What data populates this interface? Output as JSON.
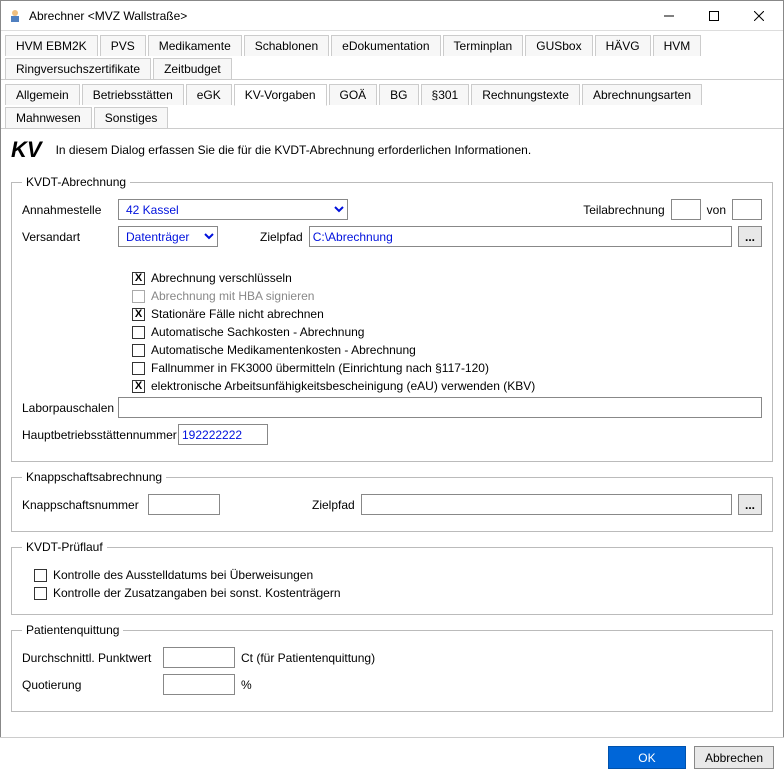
{
  "window": {
    "title": "Abrechner <MVZ Wallstraße>"
  },
  "tabs_row1": [
    "HVM EBM2K",
    "PVS",
    "Medikamente",
    "Schablonen",
    "eDokumentation",
    "Terminplan",
    "GUSbox",
    "HÄVG",
    "HVM",
    "Ringversuchszertifikate",
    "Zeitbudget"
  ],
  "tabs_row2": [
    "Allgemein",
    "Betriebsstätten",
    "eGK",
    "KV-Vorgaben",
    "GOÄ",
    "BG",
    "§301",
    "Rechnungstexte",
    "Abrechnungsarten",
    "Mahnwesen",
    "Sonstiges"
  ],
  "tabs_active": "KV-Vorgaben",
  "header": {
    "logo": "KV",
    "desc": "In diesem Dialog erfassen Sie die für die KVDT-Abrechnung erforderlichen Informationen."
  },
  "kvdt": {
    "legend": "KVDT-Abrechnung",
    "annahme_label": "Annahmestelle",
    "annahme_value": "42 Kassel",
    "teil_label": "Teilabrechnung",
    "teil_value": "",
    "von_label": "von",
    "von_value": "",
    "versand_label": "Versandart",
    "versand_value": "Datenträger",
    "zielpfad_label": "Zielpfad",
    "zielpfad_value": "C:\\Abrechnung",
    "browse": "...",
    "checks": [
      {
        "label": "Abrechnung verschlüsseln",
        "checked": true,
        "disabled": false
      },
      {
        "label": "Abrechnung mit HBA signieren",
        "checked": false,
        "disabled": true
      },
      {
        "label": "Stationäre Fälle nicht abrechnen",
        "checked": true,
        "disabled": false
      },
      {
        "label": "Automatische Sachkosten - Abrechnung",
        "checked": false,
        "disabled": false
      },
      {
        "label": "Automatische Medikamentenkosten - Abrechnung",
        "checked": false,
        "disabled": false
      },
      {
        "label": "Fallnummer in FK3000 übermitteln (Einrichtung nach §117-120)",
        "checked": false,
        "disabled": false
      },
      {
        "label": "elektronische Arbeitsunfähigkeitsbescheinigung (eAU) verwenden (KBV)",
        "checked": true,
        "disabled": false
      }
    ],
    "labor_label": "Laborpauschalen",
    "labor_value": "",
    "haupt_label": "Hauptbetriebsstättennummer",
    "haupt_value": "192222222"
  },
  "knapp": {
    "legend": "Knappschaftsabrechnung",
    "nr_label": "Knappschaftsnummer",
    "nr_value": "",
    "zielpfad_label": "Zielpfad",
    "zielpfad_value": "",
    "browse": "..."
  },
  "prueflauf": {
    "legend": "KVDT-Prüflauf",
    "checks": [
      {
        "label": "Kontrolle des Ausstelldatums bei Überweisungen",
        "checked": false
      },
      {
        "label": "Kontrolle der Zusatzangaben bei sonst. Kostenträgern",
        "checked": false
      }
    ]
  },
  "quittung": {
    "legend": "Patientenquittung",
    "punkt_label": "Durchschnittl. Punktwert",
    "punkt_value": "",
    "punkt_suffix": "Ct (für Patientenquittung)",
    "quot_label": "Quotierung",
    "quot_value": "",
    "quot_suffix": "%"
  },
  "buttons": {
    "ok": "OK",
    "cancel": "Abbrechen"
  }
}
